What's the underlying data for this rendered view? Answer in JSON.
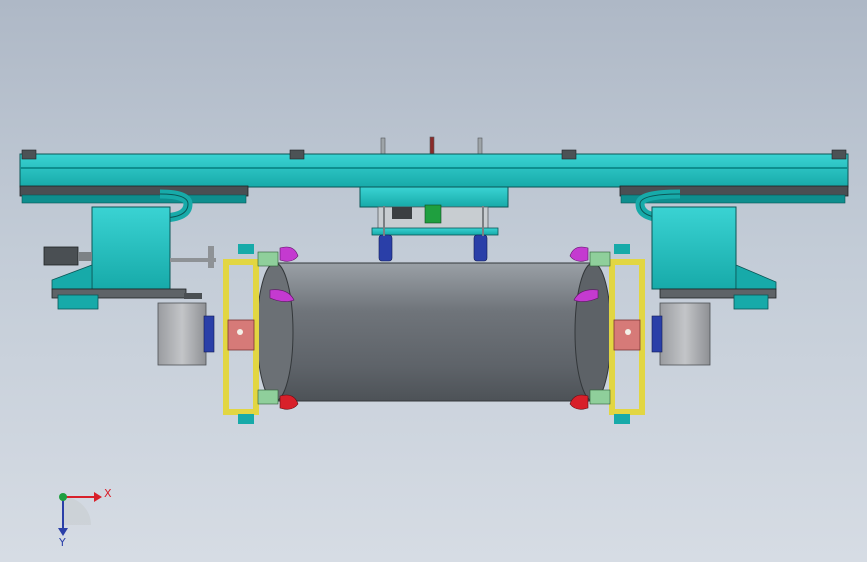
{
  "viewport": {
    "colors": {
      "frame": "#1fbfbf",
      "frame_dark": "#0e8e8e",
      "cylinder": "#7b8086",
      "bracket": "#e2d642",
      "clamp_magenta": "#c43ad0",
      "clamp_red": "#d8202a",
      "motor_body": "#a9abad",
      "flange_blue": "#2a3fa8",
      "pink_plate": "#d67a78"
    }
  },
  "triad": {
    "x_label": "X",
    "y_label": "Y",
    "x_color": "#d8202a",
    "y_color": "#2a3fa8",
    "origin_color": "#1f9f3f"
  }
}
